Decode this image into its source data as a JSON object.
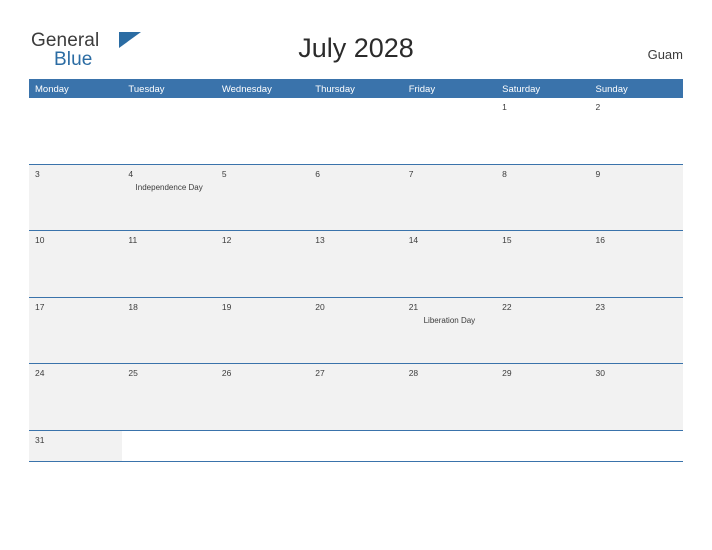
{
  "brand": {
    "name_part1": "General",
    "name_part2": "Blue"
  },
  "header": {
    "title": "July 2028",
    "country": "Guam"
  },
  "calendar": {
    "weekdays": [
      "Monday",
      "Tuesday",
      "Wednesday",
      "Thursday",
      "Friday",
      "Saturday",
      "Sunday"
    ],
    "weeks": [
      {
        "shaded": false,
        "days": [
          {
            "num": "",
            "event": ""
          },
          {
            "num": "",
            "event": ""
          },
          {
            "num": "",
            "event": ""
          },
          {
            "num": "",
            "event": ""
          },
          {
            "num": "",
            "event": ""
          },
          {
            "num": "1",
            "event": ""
          },
          {
            "num": "2",
            "event": ""
          }
        ]
      },
      {
        "shaded": true,
        "days": [
          {
            "num": "3",
            "event": ""
          },
          {
            "num": "4",
            "event": "Independence Day"
          },
          {
            "num": "5",
            "event": ""
          },
          {
            "num": "6",
            "event": ""
          },
          {
            "num": "7",
            "event": ""
          },
          {
            "num": "8",
            "event": ""
          },
          {
            "num": "9",
            "event": ""
          }
        ]
      },
      {
        "shaded": true,
        "days": [
          {
            "num": "10",
            "event": ""
          },
          {
            "num": "11",
            "event": ""
          },
          {
            "num": "12",
            "event": ""
          },
          {
            "num": "13",
            "event": ""
          },
          {
            "num": "14",
            "event": ""
          },
          {
            "num": "15",
            "event": ""
          },
          {
            "num": "16",
            "event": ""
          }
        ]
      },
      {
        "shaded": true,
        "days": [
          {
            "num": "17",
            "event": ""
          },
          {
            "num": "18",
            "event": ""
          },
          {
            "num": "19",
            "event": ""
          },
          {
            "num": "20",
            "event": ""
          },
          {
            "num": "21",
            "event": "Liberation Day"
          },
          {
            "num": "22",
            "event": ""
          },
          {
            "num": "23",
            "event": ""
          }
        ]
      },
      {
        "shaded": true,
        "days": [
          {
            "num": "24",
            "event": ""
          },
          {
            "num": "25",
            "event": ""
          },
          {
            "num": "26",
            "event": ""
          },
          {
            "num": "27",
            "event": ""
          },
          {
            "num": "28",
            "event": ""
          },
          {
            "num": "29",
            "event": ""
          },
          {
            "num": "30",
            "event": ""
          }
        ]
      },
      {
        "shaded": true,
        "last": true,
        "days": [
          {
            "num": "31",
            "event": ""
          },
          {
            "num": "",
            "event": ""
          },
          {
            "num": "",
            "event": ""
          },
          {
            "num": "",
            "event": ""
          },
          {
            "num": "",
            "event": ""
          },
          {
            "num": "",
            "event": ""
          },
          {
            "num": "",
            "event": ""
          }
        ]
      }
    ]
  },
  "colors": {
    "header_blue": "#3a73ab",
    "brand_blue": "#2b6ca3",
    "row_shade": "#f2f2f2"
  }
}
